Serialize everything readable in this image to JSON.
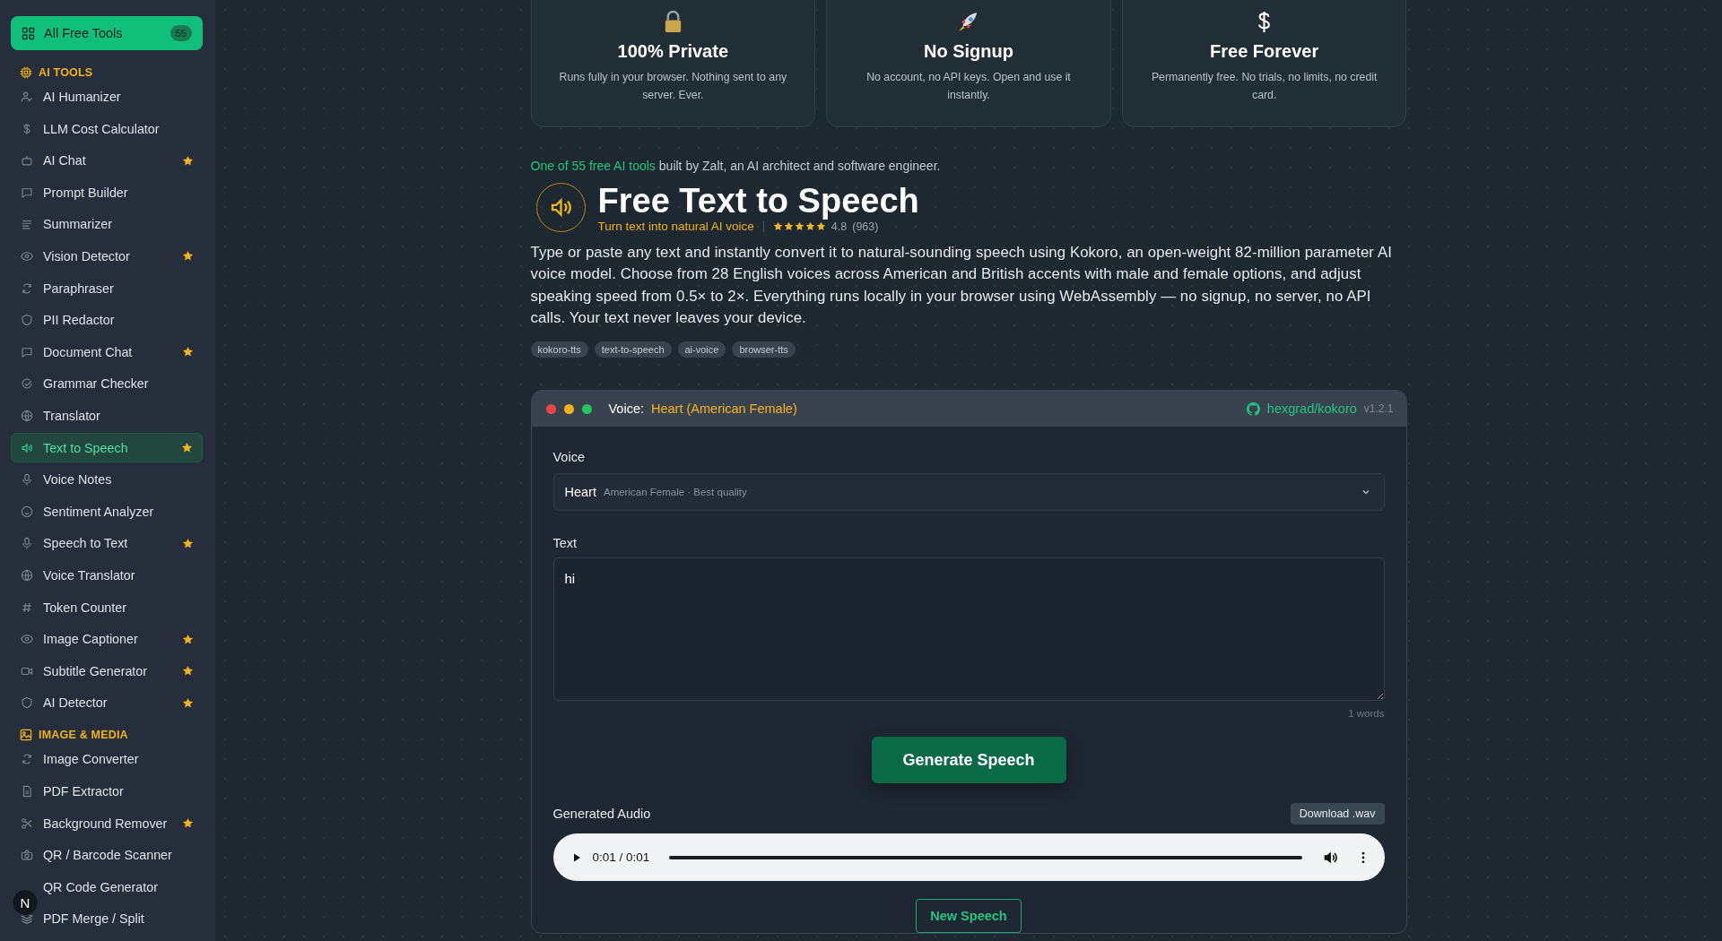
{
  "sidebar": {
    "all_tools": {
      "label": "All Free Tools",
      "count": "55"
    },
    "sections": [
      {
        "title": "AI TOOLS",
        "kind": "ai",
        "items": [
          {
            "label": "AI Humanizer",
            "starred": false,
            "selected": false
          },
          {
            "label": "LLM Cost Calculator",
            "starred": false,
            "selected": false
          },
          {
            "label": "AI Chat",
            "starred": true,
            "selected": false
          },
          {
            "label": "Prompt Builder",
            "starred": false,
            "selected": false
          },
          {
            "label": "Summarizer",
            "starred": false,
            "selected": false
          },
          {
            "label": "Vision Detector",
            "starred": true,
            "selected": false
          },
          {
            "label": "Paraphraser",
            "starred": false,
            "selected": false
          },
          {
            "label": "PII Redactor",
            "starred": false,
            "selected": false
          },
          {
            "label": "Document Chat",
            "starred": true,
            "selected": false
          },
          {
            "label": "Grammar Checker",
            "starred": false,
            "selected": false
          },
          {
            "label": "Translator",
            "starred": false,
            "selected": false
          },
          {
            "label": "Text to Speech",
            "starred": true,
            "selected": true
          },
          {
            "label": "Voice Notes",
            "starred": false,
            "selected": false
          },
          {
            "label": "Sentiment Analyzer",
            "starred": false,
            "selected": false
          },
          {
            "label": "Speech to Text",
            "starred": true,
            "selected": false
          },
          {
            "label": "Voice Translator",
            "starred": false,
            "selected": false
          },
          {
            "label": "Token Counter",
            "starred": false,
            "selected": false
          },
          {
            "label": "Image Captioner",
            "starred": true,
            "selected": false
          },
          {
            "label": "Subtitle Generator",
            "starred": true,
            "selected": false
          },
          {
            "label": "AI Detector",
            "starred": true,
            "selected": false
          }
        ]
      },
      {
        "title": "IMAGE & MEDIA",
        "kind": "image",
        "items": [
          {
            "label": "Image Converter",
            "starred": false,
            "selected": false
          },
          {
            "label": "PDF Extractor",
            "starred": false,
            "selected": false
          },
          {
            "label": "Background Remover",
            "starred": true,
            "selected": false
          },
          {
            "label": "QR / Barcode Scanner",
            "starred": false,
            "selected": false
          },
          {
            "label": "QR Code Generator",
            "starred": false,
            "selected": false
          },
          {
            "label": "PDF Merge / Split",
            "starred": false,
            "selected": false
          }
        ]
      }
    ]
  },
  "avatar": {
    "letter": "N"
  },
  "features": [
    {
      "kind": "lock",
      "title": "100% Private",
      "text": "Runs fully in your browser. Nothing sent to any server. Ever."
    },
    {
      "kind": "rocket",
      "title": "No Signup",
      "text": "No account, no API keys. Open and use it instantly."
    },
    {
      "kind": "dollar",
      "title": "Free Forever",
      "text": "Permanently free. No trials, no limits, no credit card."
    }
  ],
  "intro": {
    "link": "One of 55 free AI tools",
    "rest": "built by Zalt, an AI architect and software engineer."
  },
  "tool": {
    "title": "Free Text to Speech",
    "subtitle": "Turn text into natural AI voice",
    "stars": 4.8,
    "rating": "4.8",
    "reviews": "(963)",
    "description": "Type or paste any text and instantly convert it to natural-sounding speech using Kokoro, an open-weight 82-million parameter AI voice model. Choose from 28 English voices across American and British accents with male and female options, and adjust speaking speed from 0.5× to 2×. Everything runs locally in your browser using WebAssembly — no signup, no server, no API calls. Your text never leaves your device.",
    "tags": [
      "kokoro-tts",
      "text-to-speech",
      "ai-voice",
      "browser-tts"
    ]
  },
  "panel": {
    "header_label": "Voice:",
    "header_value": "Heart (American Female)",
    "repo": "hexgrad/kokoro",
    "version": "v1.2.1",
    "voice_label": "Voice",
    "voice_name": "Heart",
    "voice_detail": "American Female · Best quality",
    "text_label": "Text",
    "text_value": "hi",
    "word_count": "1 words",
    "generate": "Generate Speech",
    "audio_label": "Generated Audio",
    "download": "Download .wav",
    "audio": {
      "time": "0:01 / 0:01",
      "level": 1
    },
    "new": "New Speech"
  }
}
